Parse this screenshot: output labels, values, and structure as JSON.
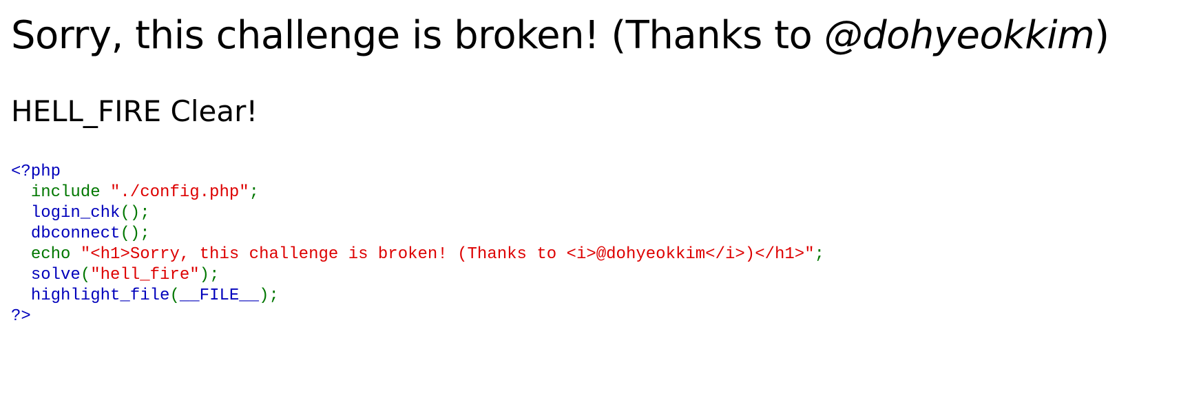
{
  "heading": {
    "prefix": "Sorry, this challenge is broken! (Thanks to ",
    "handle": "@dohyeokkim",
    "suffix": ")"
  },
  "subheading": "HELL_FIRE Clear!",
  "source": {
    "open_tag": "<?php",
    "include_kw": "include ",
    "include_path": "\"./config.php\"",
    "semicolon": ";",
    "login_fn": "login_chk",
    "dbconnect_fn": "dbconnect",
    "call_parens": "()",
    "echo_kw": "echo ",
    "echo_string": "\"<h1>Sorry, this challenge is broken! (Thanks to <i>@dohyeokkim</i>)</h1>\"",
    "solve_fn": "solve",
    "solve_open": "(",
    "solve_arg": "\"hell_fire\"",
    "solve_close": ");",
    "highlight_fn": "highlight_file",
    "highlight_open": "(",
    "highlight_arg": "__FILE__",
    "highlight_close": ");",
    "close_tag": "?>"
  },
  "colors": {
    "keyword": "#0000bb",
    "command": "#007700",
    "string": "#dd0000"
  }
}
